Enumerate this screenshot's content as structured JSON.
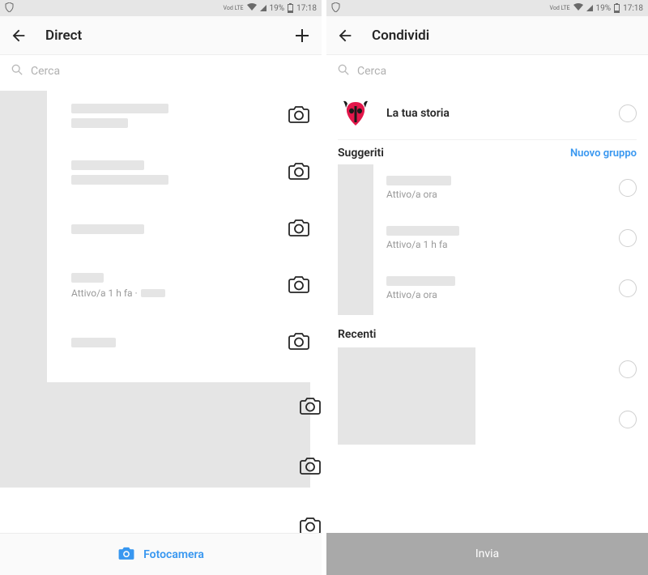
{
  "status": {
    "network": "Vod LTE",
    "battery_percent": "19%",
    "time": "17:18"
  },
  "left": {
    "title": "Direct",
    "search_placeholder": "Cerca",
    "items": [
      {
        "status": ""
      },
      {
        "status": ""
      },
      {
        "status": ""
      },
      {
        "status": "Attivo/a 1 h fa ·"
      },
      {
        "status": ""
      }
    ],
    "footer_label": "Fotocamera"
  },
  "right": {
    "title": "Condividi",
    "search_placeholder": "Cerca",
    "your_story_label": "La tua storia",
    "suggested_header": "Suggeriti",
    "new_group_label": "Nuovo gruppo",
    "suggested": [
      {
        "status": "Attivo/a ora"
      },
      {
        "status": "Attivo/a 1 h fa"
      },
      {
        "status": "Attivo/a ora"
      }
    ],
    "recent_header": "Recenti",
    "recent": [
      {
        "status": ""
      },
      {
        "status": ""
      }
    ],
    "footer_label": "Invia"
  }
}
